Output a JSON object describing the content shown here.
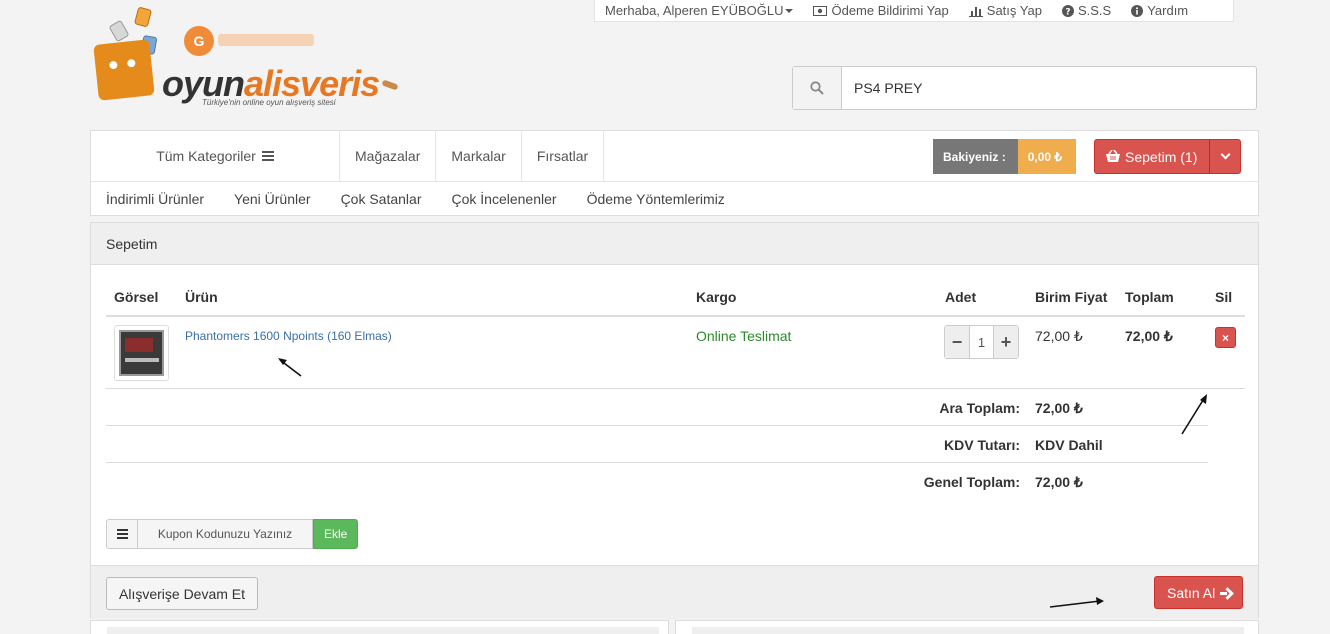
{
  "topbar": {
    "greeting": "Merhaba, Alperen EYÜBOĞLU",
    "payment_notice": "Ödeme Bildirimi Yap",
    "sell": "Satış Yap",
    "faq": "S.S.S",
    "help": "Yardım"
  },
  "logo": {
    "brand_dark": "oyun",
    "brand_orange": "alisveris",
    "tagline": "Türkiye'nin online oyun alışveriş sitesi"
  },
  "search": {
    "value": "PS4 PREY"
  },
  "nav": {
    "all_categories": "Tüm Kategoriler",
    "links": [
      "Mağazalar",
      "Markalar",
      "Fırsatlar"
    ],
    "sub_links": [
      "İndirimli Ürünler",
      "Yeni Ürünler",
      "Çok Satanlar",
      "Çok İncelenenler",
      "Ödeme Yöntemlerimiz"
    ],
    "balance_label": "Bakiyeniz :",
    "balance_value": "0,00 ₺",
    "cart_label": "Sepetim (1)"
  },
  "cart": {
    "title": "Sepetim",
    "headers": {
      "image": "Görsel",
      "product": "Ürün",
      "shipping": "Kargo",
      "qty": "Adet",
      "unit_price": "Birim Fiyat",
      "total": "Toplam",
      "delete": "Sil"
    },
    "item": {
      "name": "Phantomers 1600 Npoints (160 Elmas)",
      "shipping": "Online Teslimat",
      "qty": "1",
      "unit_price": "72,00 ₺",
      "total": "72,00 ₺",
      "minus": "−",
      "plus": "+",
      "delete_icon": "×"
    },
    "summary": {
      "subtotal_label": "Ara Toplam:",
      "subtotal_value": "72,00 ₺",
      "tax_label": "KDV Tutarı:",
      "tax_value": "KDV Dahil",
      "grand_label": "Genel Toplam:",
      "grand_value": "72,00 ₺"
    },
    "coupon": {
      "placeholder": "Kupon Kodunuzu Yazınız",
      "add": "Ekle"
    },
    "continue": "Alışverişe Devam Et",
    "buy": "Satın Al"
  },
  "icons": {
    "user_caret": "caret-down-icon",
    "payment": "money-icon",
    "sell": "bar-chart-icon",
    "faq": "question-circle-icon",
    "help": "info-circle-icon",
    "search": "search-icon",
    "menu": "bars-icon",
    "basket": "basket-icon",
    "dropdown": "chevron-down-icon",
    "delete": "close-icon",
    "buy_arrow": "arrow-right-icon"
  },
  "colors": {
    "accent_orange": "#e87722",
    "danger": "#d9534f",
    "success": "#5cb85c",
    "warning": "#f0ad4e",
    "link": "#3a6fa8",
    "shipping_green": "#2b8a2b"
  }
}
